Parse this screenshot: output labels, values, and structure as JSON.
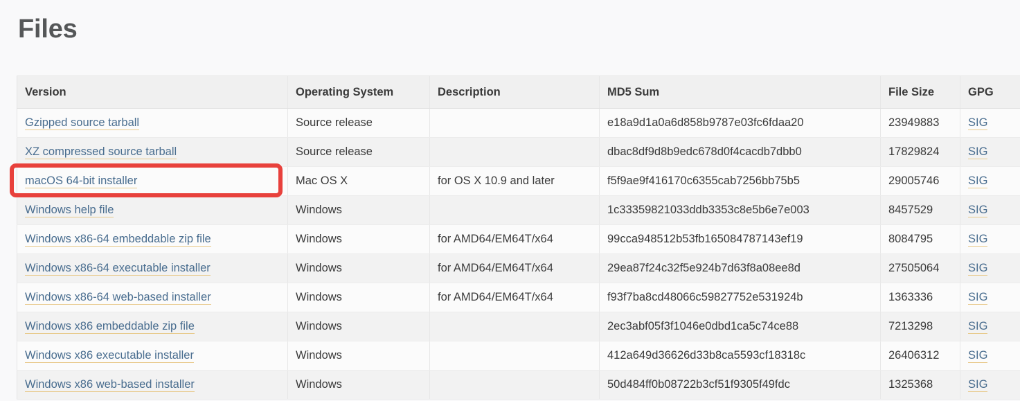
{
  "page": {
    "title": "Files",
    "accent_link_color": "#496d8f",
    "link_underline_color": "#e8c98a",
    "highlight_color": "#e8413c",
    "header_bg": "#f0f0f0",
    "row_odd_bg": "#fbfbfb",
    "row_even_bg": "#f2f2f2"
  },
  "table": {
    "columns": [
      "Version",
      "Operating System",
      "Description",
      "MD5 Sum",
      "File Size",
      "GPG"
    ],
    "gpg_label": "SIG",
    "rows": [
      {
        "version": "Gzipped source tarball",
        "os": "Source release",
        "description": "",
        "md5": "e18a9d1a0a6d858b9787e03fc6fdaa20",
        "size": "23949883",
        "gpg": "SIG"
      },
      {
        "version": "XZ compressed source tarball",
        "os": "Source release",
        "description": "",
        "md5": "dbac8df9d8b9edc678d0f4cacdb7dbb0",
        "size": "17829824",
        "gpg": "SIG"
      },
      {
        "version": "macOS 64-bit installer",
        "os": "Mac OS X",
        "description": "for OS X 10.9 and later",
        "md5": "f5f9ae9f416170c6355cab7256bb75b5",
        "size": "29005746",
        "gpg": "SIG"
      },
      {
        "version": "Windows help file",
        "os": "Windows",
        "description": "",
        "md5": "1c33359821033ddb3353c8e5b6e7e003",
        "size": "8457529",
        "gpg": "SIG"
      },
      {
        "version": "Windows x86-64 embeddable zip file",
        "os": "Windows",
        "description": "for AMD64/EM64T/x64",
        "md5": "99cca948512b53fb165084787143ef19",
        "size": "8084795",
        "gpg": "SIG"
      },
      {
        "version": "Windows x86-64 executable installer",
        "os": "Windows",
        "description": "for AMD64/EM64T/x64",
        "md5": "29ea87f24c32f5e924b7d63f8a08ee8d",
        "size": "27505064",
        "gpg": "SIG"
      },
      {
        "version": "Windows x86-64 web-based installer",
        "os": "Windows",
        "description": "for AMD64/EM64T/x64",
        "md5": "f93f7ba8cd48066c59827752e531924b",
        "size": "1363336",
        "gpg": "SIG"
      },
      {
        "version": "Windows x86 embeddable zip file",
        "os": "Windows",
        "description": "",
        "md5": "2ec3abf05f3f1046e0dbd1ca5c74ce88",
        "size": "7213298",
        "gpg": "SIG"
      },
      {
        "version": "Windows x86 executable installer",
        "os": "Windows",
        "description": "",
        "md5": "412a649d36626d33b8ca5593cf18318c",
        "size": "26406312",
        "gpg": "SIG"
      },
      {
        "version": "Windows x86 web-based installer",
        "os": "Windows",
        "description": "",
        "md5": "50d484ff0b08722b3cf51f9305f49fdc",
        "size": "1325368",
        "gpg": "SIG"
      }
    ]
  },
  "annotation": {
    "target_row_index": 2,
    "target_label": "macOS 64-bit installer"
  }
}
